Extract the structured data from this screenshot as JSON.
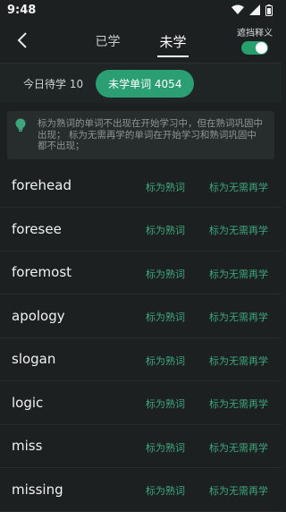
{
  "status_bar": {
    "time": "9:48"
  },
  "header": {
    "tabs": [
      {
        "label": "已学"
      },
      {
        "label": "未学"
      }
    ],
    "toggle_label": "遮挡释义"
  },
  "filters": {
    "today": "今日待学 10",
    "unlearned": "未学单词 4054"
  },
  "tip": {
    "text": "标为熟词的单词不出现在开始学习中，但在熟词巩固中出现； 标为无需再学的单词在开始学习和熟词巩固中都不出现；"
  },
  "actions": {
    "mark_known": "标为熟词",
    "mark_skip": "标为无需再学"
  },
  "words": [
    {
      "word": "forehead"
    },
    {
      "word": "foresee"
    },
    {
      "word": "foremost"
    },
    {
      "word": "apology"
    },
    {
      "word": "slogan"
    },
    {
      "word": "logic"
    },
    {
      "word": "miss"
    },
    {
      "word": "missing"
    }
  ],
  "colors": {
    "accent": "#2b9e73",
    "background": "#1c2020"
  }
}
